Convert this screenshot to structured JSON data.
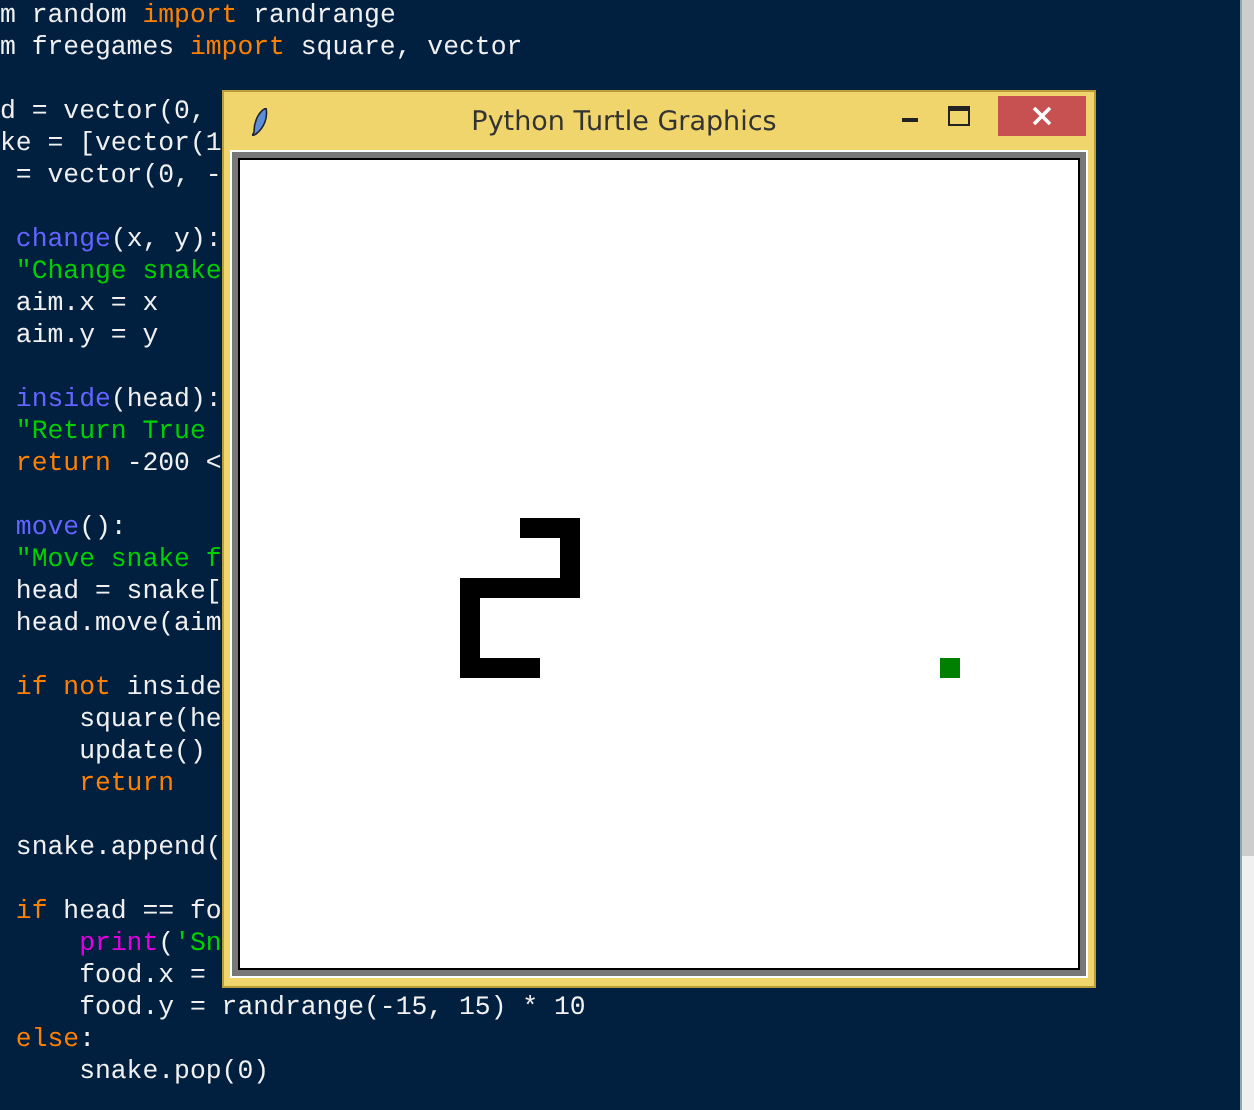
{
  "editor": {
    "blocks": [
      {
        "lines": [
          {
            "tokens": [
              {
                "text": "m random ",
                "kind": "plain"
              },
              {
                "text": "import",
                "kind": "keyword"
              },
              {
                "text": " randrange",
                "kind": "plain"
              }
            ]
          },
          {
            "tokens": [
              {
                "text": "m freegames ",
                "kind": "plain"
              },
              {
                "text": "import",
                "kind": "keyword"
              },
              {
                "text": " square, vector",
                "kind": "plain"
              }
            ]
          }
        ]
      },
      {
        "lines": [
          {
            "tokens": [
              {
                "text": "d = vector(0,",
                "kind": "plain"
              }
            ]
          },
          {
            "tokens": [
              {
                "text": "ke = [vector(1",
                "kind": "plain"
              }
            ]
          },
          {
            "tokens": [
              {
                "text": " = vector(0, -",
                "kind": "plain"
              }
            ]
          }
        ]
      },
      {
        "lines": [
          {
            "tokens": [
              {
                "text": " change",
                "kind": "name"
              },
              {
                "text": "(x, y):",
                "kind": "plain"
              }
            ]
          },
          {
            "tokens": [
              {
                "text": " \"Change snake",
                "kind": "string"
              }
            ]
          },
          {
            "tokens": [
              {
                "text": " aim.x = x",
                "kind": "plain"
              }
            ]
          },
          {
            "tokens": [
              {
                "text": " aim.y = y",
                "kind": "plain"
              }
            ]
          }
        ]
      },
      {
        "lines": [
          {
            "tokens": [
              {
                "text": " inside",
                "kind": "name"
              },
              {
                "text": "(head):",
                "kind": "plain"
              }
            ]
          },
          {
            "tokens": [
              {
                "text": " \"Return True",
                "kind": "string"
              }
            ]
          },
          {
            "tokens": [
              {
                "text": " return",
                "kind": "keyword"
              },
              {
                "text": " -200 <",
                "kind": "plain"
              }
            ]
          }
        ]
      },
      {
        "lines": [
          {
            "tokens": [
              {
                "text": " move",
                "kind": "name"
              },
              {
                "text": "():",
                "kind": "plain"
              }
            ]
          },
          {
            "tokens": [
              {
                "text": " \"Move snake f",
                "kind": "string"
              }
            ]
          },
          {
            "tokens": [
              {
                "text": " head = snake[",
                "kind": "plain"
              }
            ]
          },
          {
            "tokens": [
              {
                "text": " head.move(aim",
                "kind": "plain"
              }
            ]
          }
        ]
      },
      {
        "lines": [
          {
            "tokens": [
              {
                "text": " if not",
                "kind": "keyword"
              },
              {
                "text": " inside",
                "kind": "plain"
              }
            ]
          },
          {
            "tokens": [
              {
                "text": "     square(he",
                "kind": "plain"
              }
            ]
          },
          {
            "tokens": [
              {
                "text": "     update()",
                "kind": "plain"
              }
            ]
          },
          {
            "tokens": [
              {
                "text": "     return",
                "kind": "keyword"
              }
            ]
          }
        ]
      },
      {
        "lines": [
          {
            "tokens": [
              {
                "text": " snake.append(",
                "kind": "plain"
              }
            ]
          }
        ]
      },
      {
        "lines": [
          {
            "tokens": [
              {
                "text": " if",
                "kind": "keyword"
              },
              {
                "text": " head == fo",
                "kind": "plain"
              }
            ]
          },
          {
            "tokens": [
              {
                "text": "     print",
                "kind": "builtin"
              },
              {
                "text": "(",
                "kind": "plain"
              },
              {
                "text": "'Sn",
                "kind": "string"
              }
            ]
          },
          {
            "tokens": [
              {
                "text": "     food.x = ",
                "kind": "plain"
              }
            ]
          },
          {
            "tokens": [
              {
                "text": "     food.y = randrange(-15, 15) * 10",
                "kind": "plain"
              }
            ]
          },
          {
            "tokens": [
              {
                "text": " else",
                "kind": "keyword"
              },
              {
                "text": ":",
                "kind": "plain"
              }
            ]
          },
          {
            "tokens": [
              {
                "text": "     snake.pop(0)",
                "kind": "plain"
              }
            ]
          }
        ]
      }
    ]
  },
  "window": {
    "title": "Python Turtle Graphics"
  }
}
